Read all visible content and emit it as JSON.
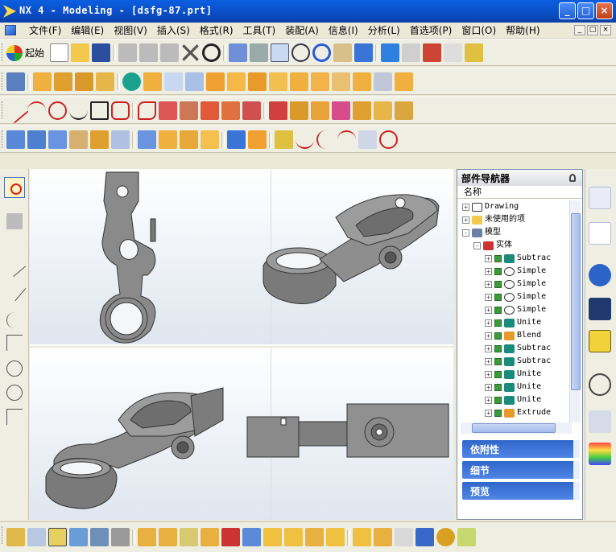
{
  "window": {
    "title": "NX 4 - Modeling - [dsfg-87.prt]",
    "buttons": [
      "_",
      "□",
      "×"
    ]
  },
  "menu": {
    "items": [
      "文件(F)",
      "编辑(E)",
      "视图(V)",
      "插入(S)",
      "格式(R)",
      "工具(T)",
      "装配(A)",
      "信息(I)",
      "分析(L)",
      "首选项(P)",
      "窗口(O)",
      "帮助(H)"
    ],
    "mdi_buttons": [
      "_",
      "□",
      "×"
    ]
  },
  "toolbar": {
    "start_label": "起始",
    "start_icon": "nx-start-icon"
  },
  "navigator": {
    "title": "部件导航器",
    "column": "名称",
    "tree": [
      {
        "label": "Drawing",
        "icon": "drawing-icon",
        "level": 0,
        "expand": "+"
      },
      {
        "label": "未使用的项",
        "icon": "folder-icon",
        "level": 0,
        "expand": "+"
      },
      {
        "label": "模型",
        "icon": "model-icon",
        "level": 0,
        "expand": "-"
      },
      {
        "label": "实体",
        "icon": "body-icon",
        "level": 1,
        "expand": "-"
      },
      {
        "label": "Subtrac",
        "icon": "subtract-icon",
        "level": 2,
        "expand": "+"
      },
      {
        "label": "Simple",
        "icon": "hole-icon",
        "level": 2,
        "expand": "+"
      },
      {
        "label": "Simple",
        "icon": "hole-icon",
        "level": 2,
        "expand": "+"
      },
      {
        "label": "Simple",
        "icon": "hole-icon",
        "level": 2,
        "expand": "+"
      },
      {
        "label": "Simple",
        "icon": "hole-icon",
        "level": 2,
        "expand": "+"
      },
      {
        "label": "Unite",
        "icon": "unite-icon",
        "level": 2,
        "expand": "+"
      },
      {
        "label": "Blend",
        "icon": "blend-icon",
        "level": 2,
        "expand": "+"
      },
      {
        "label": "Subtrac",
        "icon": "subtract-icon",
        "level": 2,
        "expand": "+"
      },
      {
        "label": "Subtrac",
        "icon": "subtract-icon",
        "level": 2,
        "expand": "+"
      },
      {
        "label": "Unite",
        "icon": "unite-icon",
        "level": 2,
        "expand": "+"
      },
      {
        "label": "Unite",
        "icon": "unite-icon",
        "level": 2,
        "expand": "+"
      },
      {
        "label": "Unite",
        "icon": "unite-icon",
        "level": 2,
        "expand": "+"
      },
      {
        "label": "Extrude",
        "icon": "extrude-icon",
        "level": 2,
        "expand": "+"
      }
    ],
    "sections": [
      "依附性",
      "细节",
      "预览"
    ]
  },
  "colors": {
    "title_bar": "#0b4fc8",
    "section_header": "#3a72d6",
    "viewport_bg": "#e6ebf2"
  }
}
